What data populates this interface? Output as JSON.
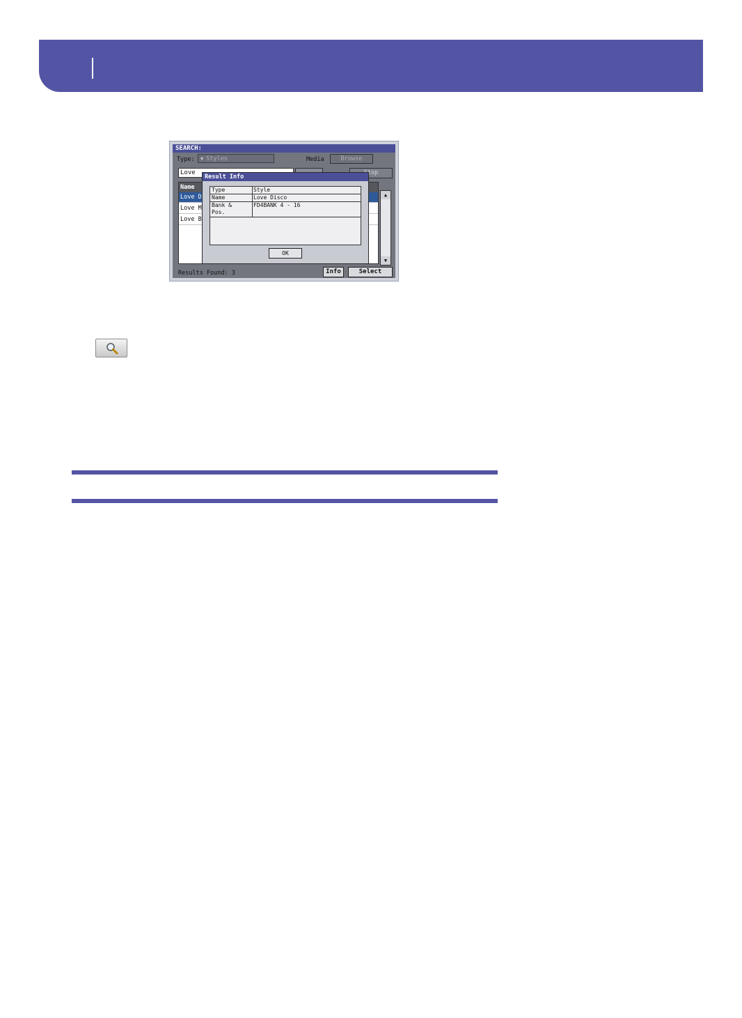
{
  "search_screen": {
    "title": "SEARCH:",
    "type_label": "Type:",
    "type_value": "Styles",
    "media_label": "Media",
    "browse_label": "Browse",
    "search_value": "Love",
    "stop_label": "Stop",
    "list_header": "Name",
    "results": [
      "Love D",
      "Love M",
      "Love B"
    ],
    "results_found": "Results Found:  3",
    "info_label": "Info",
    "select_label": "Select"
  },
  "result_info": {
    "title": "Result Info",
    "rows": [
      {
        "key": "Type",
        "value": "Style"
      },
      {
        "key": "Name",
        "value": "Love Disco"
      },
      {
        "key": "Bank & Pos.",
        "value": "FD4BANK 4 - 16"
      }
    ],
    "ok_label": "OK"
  },
  "icons": {
    "dropdown": "chevron-down-icon",
    "search": "magnifier-icon",
    "scroll_up": "scroll-up-arrow-icon",
    "scroll_down": "scroll-down-arrow-icon"
  },
  "colors": {
    "header_band": "#5355a4",
    "title_bar": "#4a4f97",
    "selected_row": "#2f5a9a"
  }
}
